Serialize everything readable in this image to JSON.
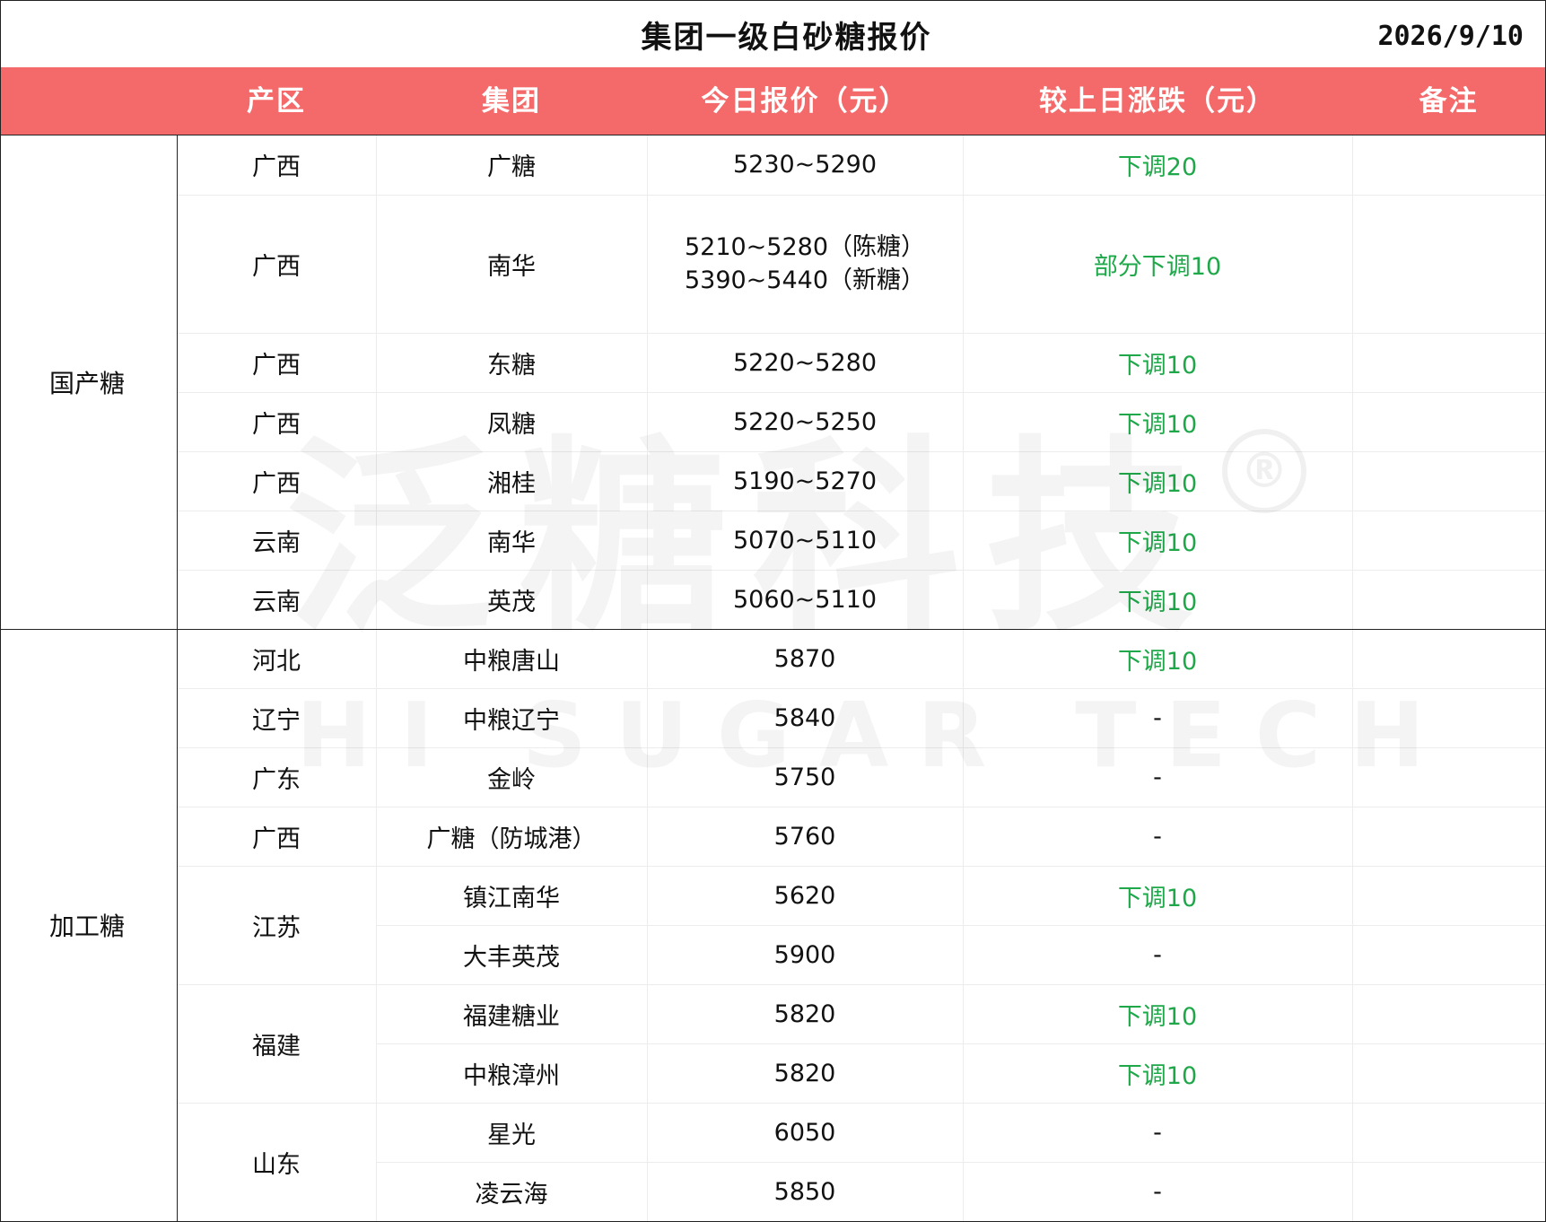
{
  "title": "集团一级白砂糖报价",
  "date": "2026/9/10",
  "header": {
    "region": "产区",
    "group": "集团",
    "price": "今日报价（元）",
    "change": "较上日涨跌（元）",
    "note": "备注"
  },
  "categories": {
    "domestic": "国产糖",
    "processed": "加工糖"
  },
  "rows": [
    {
      "region": "广西",
      "group": "广糖",
      "price": "5230~5290",
      "change": "下调20",
      "note": ""
    },
    {
      "region": "广西",
      "group": "南华",
      "price_lines": [
        "5210~5280（陈糖）",
        "5390~5440（新糖）"
      ],
      "change": "部分下调10",
      "note": ""
    },
    {
      "region": "广西",
      "group": "东糖",
      "price": "5220~5280",
      "change": "下调10",
      "note": ""
    },
    {
      "region": "广西",
      "group": "凤糖",
      "price": "5220~5250",
      "change": "下调10",
      "note": ""
    },
    {
      "region": "广西",
      "group": "湘桂",
      "price": "5190~5270",
      "change": "下调10",
      "note": ""
    },
    {
      "region": "云南",
      "group": "南华",
      "price": "5070~5110",
      "change": "下调10",
      "note": ""
    },
    {
      "region": "云南",
      "group": "英茂",
      "price": "5060~5110",
      "change": "下调10",
      "note": ""
    },
    {
      "region": "河北",
      "group": "中粮唐山",
      "price": "5870",
      "change": "下调10",
      "note": ""
    },
    {
      "region": "辽宁",
      "group": "中粮辽宁",
      "price": "5840",
      "change": "-",
      "note": ""
    },
    {
      "region": "广东",
      "group": "金岭",
      "price": "5750",
      "change": "-",
      "note": ""
    },
    {
      "region": "广西",
      "group": "广糖（防城港）",
      "price": "5760",
      "change": "-",
      "note": ""
    },
    {
      "region": "江苏",
      "group": "镇江南华",
      "price": "5620",
      "change": "下调10",
      "note": ""
    },
    {
      "region": "",
      "group": "大丰英茂",
      "price": "5900",
      "change": "-",
      "note": ""
    },
    {
      "region": "福建",
      "group": "福建糖业",
      "price": "5820",
      "change": "下调10",
      "note": ""
    },
    {
      "region": "",
      "group": "中粮漳州",
      "price": "5820",
      "change": "下调10",
      "note": ""
    },
    {
      "region": "山东",
      "group": "星光",
      "price": "6050",
      "change": "-",
      "note": ""
    },
    {
      "region": "",
      "group": "凌云海",
      "price": "5850",
      "change": "-",
      "note": ""
    }
  ],
  "colors": {
    "header_bg": "#f46a6a",
    "header_text": "#ffffff",
    "change_down": "#1fa84a"
  },
  "watermark": {
    "cn": "泛糖科技",
    "en": "HI SUGAR TECH",
    "mark": "®"
  }
}
